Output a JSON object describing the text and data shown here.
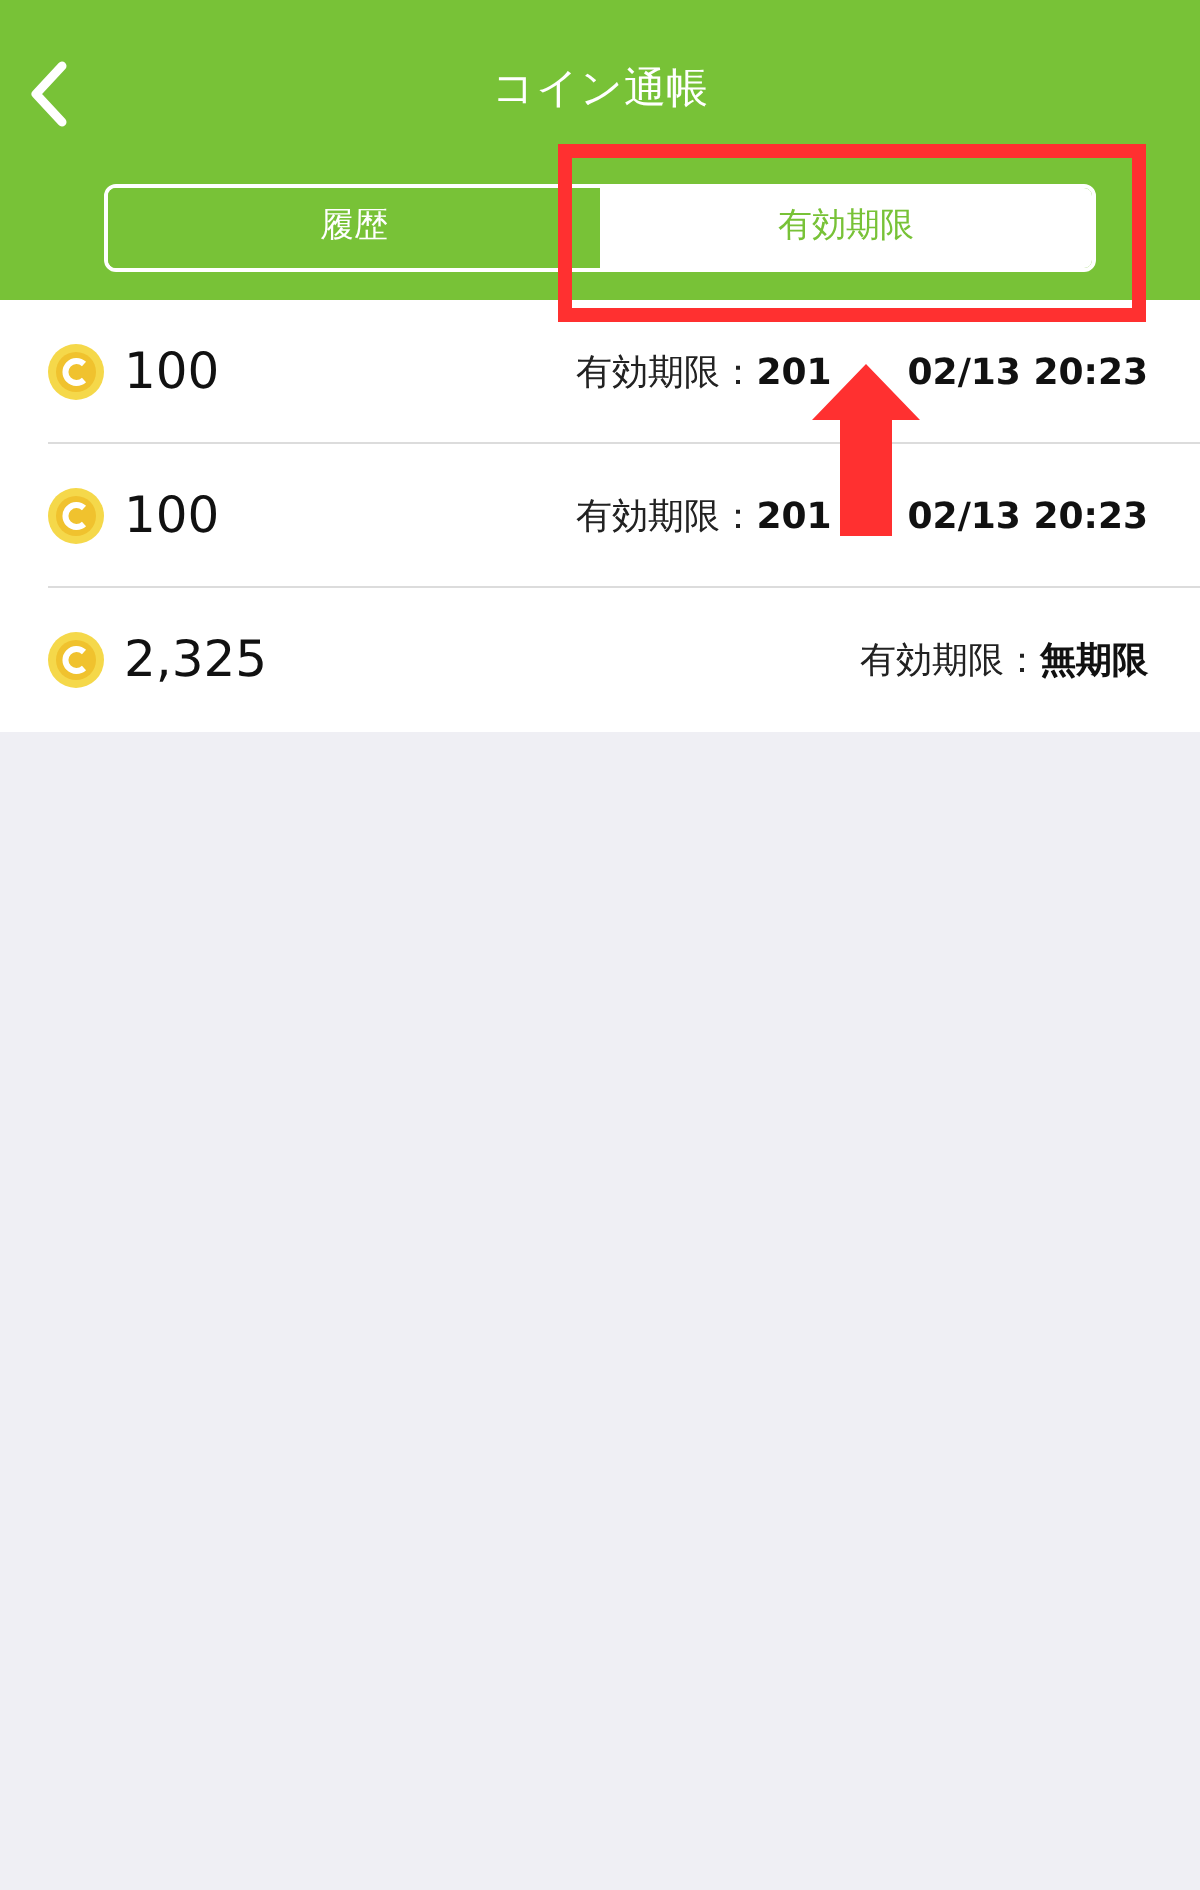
{
  "header": {
    "title": "コイン通帳"
  },
  "tabs": [
    {
      "label": "履歴",
      "selected": false
    },
    {
      "label": "有効期限",
      "selected": true
    }
  ],
  "rows": [
    {
      "amount": "100",
      "expiry_label": "有効期限：",
      "expiry_parts": [
        "201",
        "02/13 20:23"
      ]
    },
    {
      "amount": "100",
      "expiry_label": "有効期限：",
      "expiry_parts": [
        "201",
        "02/13 20:23"
      ]
    },
    {
      "amount": "2,325",
      "expiry_label": "有効期限：",
      "expiry_parts": [
        "無期限"
      ]
    }
  ]
}
